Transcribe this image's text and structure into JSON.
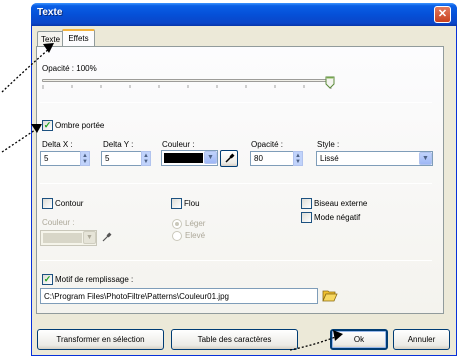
{
  "window": {
    "title": "Texte",
    "close_label": "✕"
  },
  "tabs": [
    {
      "label": "Texte"
    },
    {
      "label": "Effets"
    }
  ],
  "opacity": {
    "label": "Opacité : 100%",
    "value_percent": 100
  },
  "ombre": {
    "checkbox_label": "Ombre portée",
    "deltax_label": "Delta X :",
    "deltax_value": "5",
    "deltay_label": "Delta Y :",
    "deltay_value": "5",
    "couleur_label": "Couleur :",
    "couleur_value": "#000000",
    "opacite_label": "Opacité :",
    "opacite_value": "80",
    "style_label": "Style :",
    "style_value": "Lissé"
  },
  "effects": {
    "contour_label": "Contour",
    "couleur_label": "Couleur :",
    "flou_label": "Flou",
    "leger_label": "Léger",
    "eleve_label": "Elevé",
    "biseau_label": "Biseau externe",
    "negatif_label": "Mode négatif"
  },
  "motif": {
    "checkbox_label": "Motif de remplissage :",
    "path_value": "C:\\Program Files\\PhotoFiltre\\Patterns\\Couleur01.jpg"
  },
  "buttons": {
    "transformer": "Transformer en sélection",
    "table": "Table des caractères",
    "ok": "Ok",
    "annuler": "Annuler"
  },
  "colors": {
    "titlebar": "#0550d8",
    "check": "#21a121",
    "folder": "#f0c030"
  }
}
